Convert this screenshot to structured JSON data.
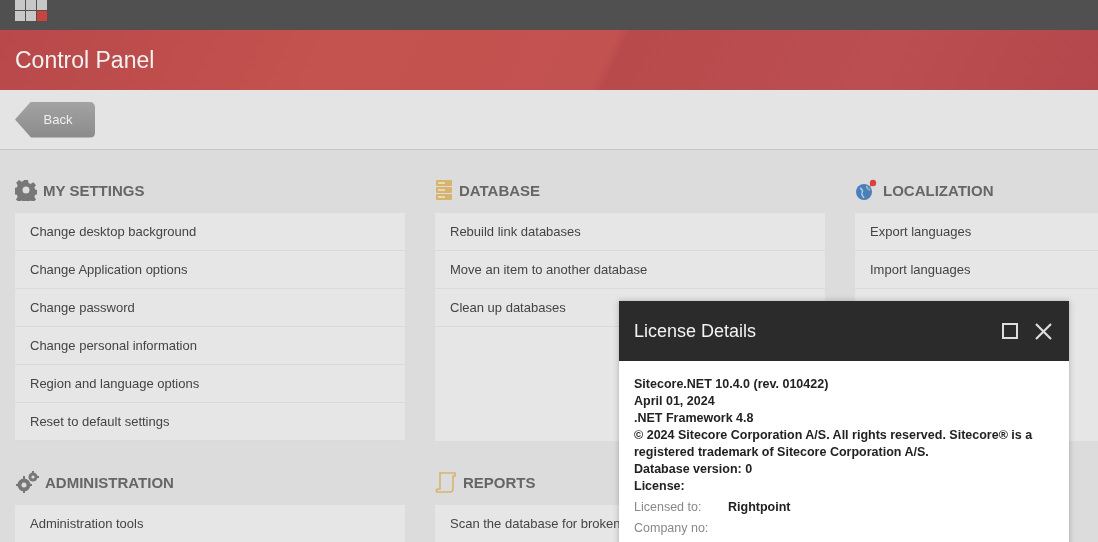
{
  "header": {
    "title": "Control Panel"
  },
  "back_button": {
    "label": "Back"
  },
  "sections": [
    {
      "kind": "settings",
      "title": "MY SETTINGS",
      "items": [
        "Change desktop background",
        "Change Application options",
        "Change password",
        "Change personal information",
        "Region and language options",
        "Reset to default settings"
      ]
    },
    {
      "kind": "database",
      "title": "DATABASE",
      "items": [
        "Rebuild link databases",
        "Move an item to another database",
        "Clean up databases"
      ]
    },
    {
      "kind": "localization",
      "title": "LOCALIZATION",
      "items": [
        "Export languages",
        "Import languages"
      ]
    },
    {
      "kind": "administration",
      "title": "ADMINISTRATION",
      "items": [
        "Administration tools"
      ]
    },
    {
      "kind": "reports",
      "title": "REPORTS",
      "items": [
        "Scan the database for broken"
      ]
    }
  ],
  "dialog": {
    "title": "License Details",
    "lines": [
      "Sitecore.NET 10.4.0 (rev. 010422)",
      "April 01, 2024",
      ".NET Framework 4.8",
      "© 2024 Sitecore Corporation A/S. All rights reserved. Sitecore® is a registered trademark of Sitecore Corporation A/S.",
      "Database version: 0",
      "License:"
    ],
    "fields": [
      {
        "label": "Licensed to:",
        "value": "Rightpoint"
      },
      {
        "label": "Company no:"
      }
    ]
  }
}
